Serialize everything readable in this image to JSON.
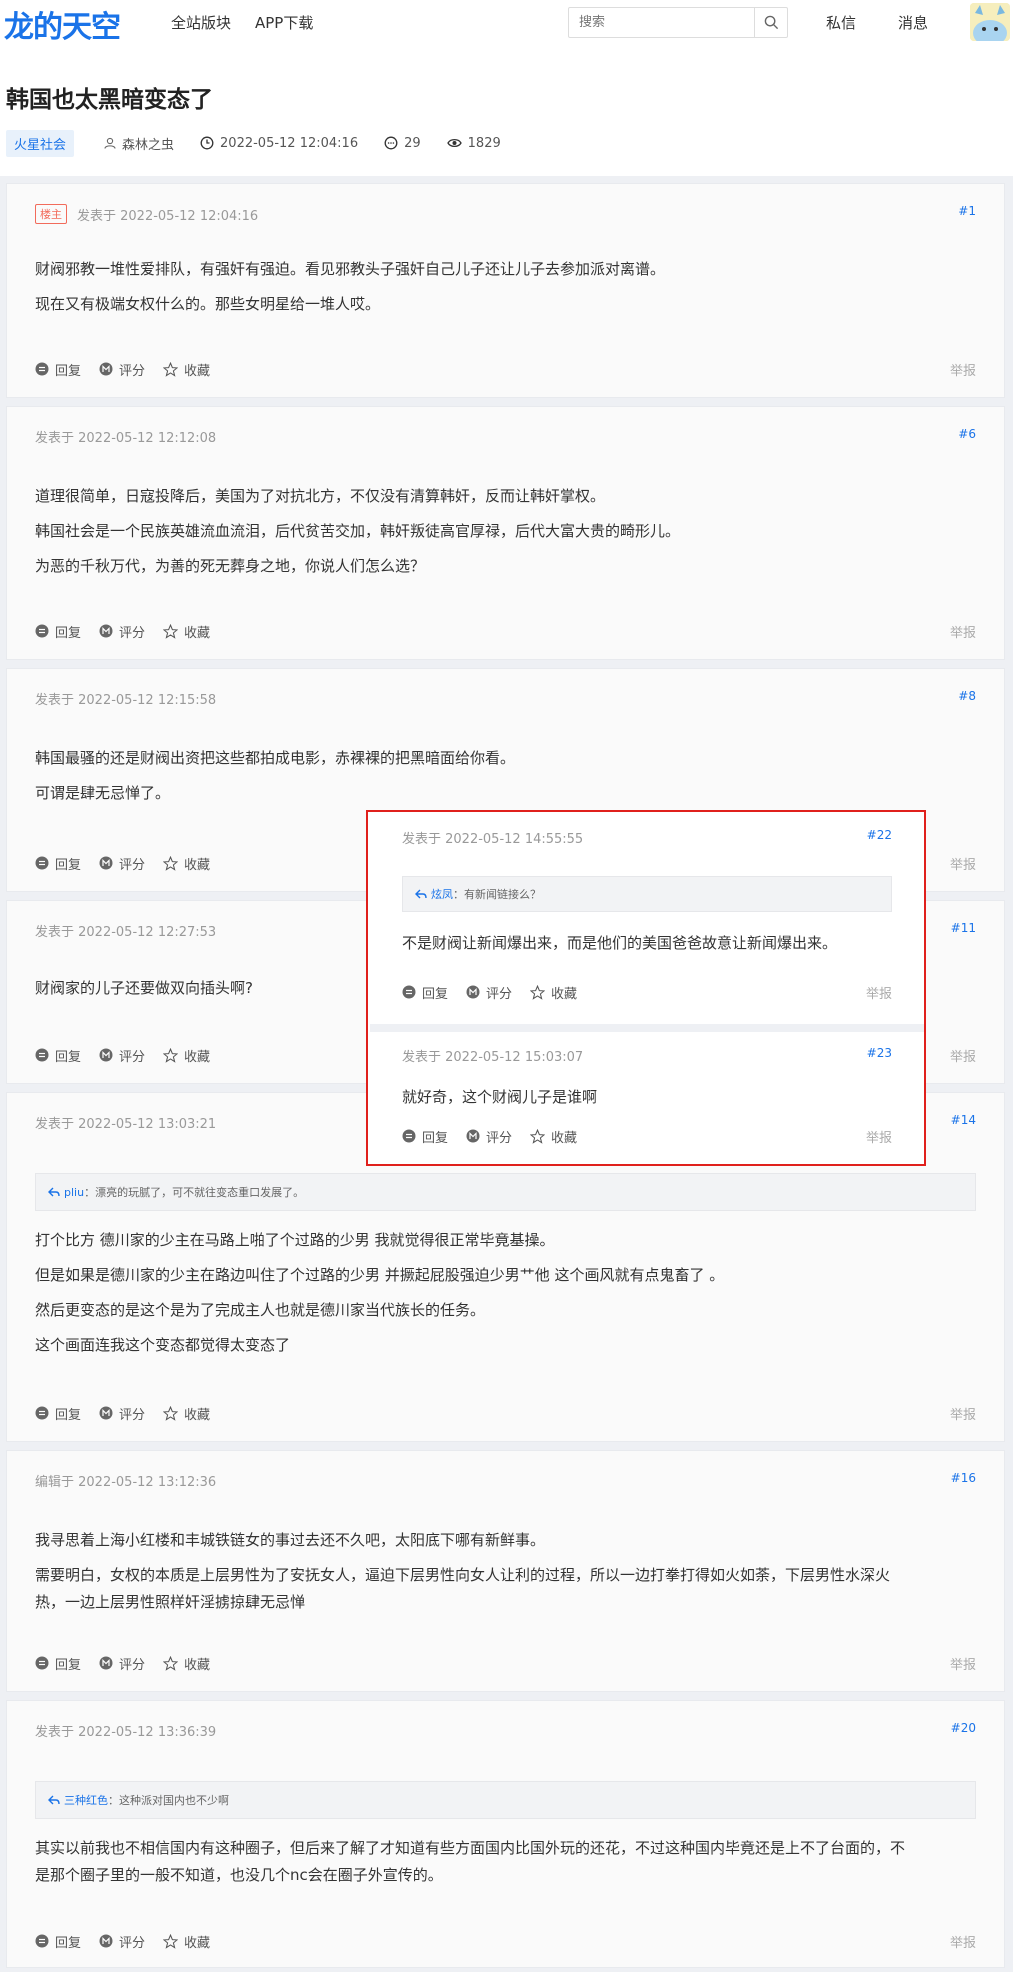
{
  "header": {
    "logo": "龙的天空",
    "nav": [
      "全站版块",
      "APP下载"
    ],
    "search_placeholder": "搜索",
    "messages": "私信",
    "notifications": "消息"
  },
  "thread": {
    "title": "韩国也太黑暗变态了",
    "forum_tag": "火星社会",
    "author": "森林之虫",
    "time": "2022-05-12 12:04:16",
    "replies": "29",
    "views": "1829"
  },
  "labels": {
    "op_badge": "楼主",
    "reply": "回复",
    "rate": "评分",
    "favorite": "收藏",
    "report": "举报"
  },
  "posts": [
    {
      "head": "发表于 2022-05-12 12:04:16",
      "floor": "#1",
      "lines": [
        "财阀邪教一堆性爱排队，有强奸有强迫。看见邪教头子强奸自己儿子还让儿子去参加派对离谱。",
        "现在又有极端女权什么的。那些女明星给一堆人哎。"
      ]
    },
    {
      "head": "发表于 2022-05-12 12:12:08",
      "floor": "#6",
      "lines": [
        "道理很简单，日寇投降后，美国为了对抗北方，不仅没有清算韩奸，反而让韩奸掌权。",
        "韩国社会是一个民族英雄流血流泪，后代贫苦交加，韩奸叛徒高官厚禄，后代大富大贵的畸形儿。",
        "为恶的千秋万代，为善的死无葬身之地，你说人们怎么选？"
      ]
    },
    {
      "head": "发表于 2022-05-12 12:15:58",
      "floor": "#8",
      "lines": [
        "韩国最骚的还是财阀出资把这些都拍成电影，赤裸裸的把黑暗面给你看。",
        "可谓是肆无忌惮了。"
      ]
    },
    {
      "head": "发表于 2022-05-12 12:27:53",
      "floor": "#11",
      "lines": [
        "财阀家的儿子还要做双向插头啊?"
      ]
    },
    {
      "head": "发表于 2022-05-12 13:03:21",
      "floor": "#14",
      "quote_user": "pliu",
      "quote_text": "：漂亮的玩腻了，可不就往变态重口发展了。",
      "lines": [
        "打个比方 德川家的少主在马路上啪了个过路的少男 我就觉得很正常毕竟基操。",
        "但是如果是德川家的少主在路边叫住了个过路的少男 并撅起屁股强迫少男艹他 这个画风就有点鬼畜了 。",
        "然后更变态的是这个是为了完成主人也就是德川家当代族长的任务。",
        "这个画面连我这个变态都觉得太变态了"
      ]
    },
    {
      "head": "编辑于 2022-05-12 13:12:36",
      "floor": "#16",
      "lines": [
        "我寻思着上海小红楼和丰城铁链女的事过去还不久吧，太阳底下哪有新鲜事。",
        "需要明白，女权的本质是上层男性为了安抚女人，逼迫下层男性向女人让利的过程，所以一边打拳打得如火如荼，下层男性水深火",
        "热，一边上层男性照样奸淫掳掠肆无忌惮"
      ]
    },
    {
      "head": "发表于 2022-05-12 13:36:39",
      "floor": "#20",
      "quote_user": "三种红色",
      "quote_text": "：这种派对国内也不少啊",
      "lines": [
        "其实以前我也不相信国内有这种圈子，但后来了解了才知道有些方面国内比国外玩的还花，不过这种国内毕竟还是上不了台面的，不",
        "是那个圈子里的一般不知道，也没几个nc会在圈子外宣传的。"
      ]
    }
  ],
  "popup": [
    {
      "head": "发表于 2022-05-12 14:55:55",
      "floor": "#22",
      "quote_user": "炫凤",
      "quote_text": "：有新闻链接么？",
      "lines": [
        "不是财阀让新闻爆出来，而是他们的美国爸爸故意让新闻爆出来。"
      ]
    },
    {
      "head": "发表于 2022-05-12 15:03:07",
      "floor": "#23",
      "lines": [
        "就好奇，这个财阀儿子是谁啊"
      ]
    }
  ],
  "colors": {
    "accent": "#1a73e8",
    "highlight_border": "#e0201c",
    "op_badge": "#f26b5b"
  }
}
